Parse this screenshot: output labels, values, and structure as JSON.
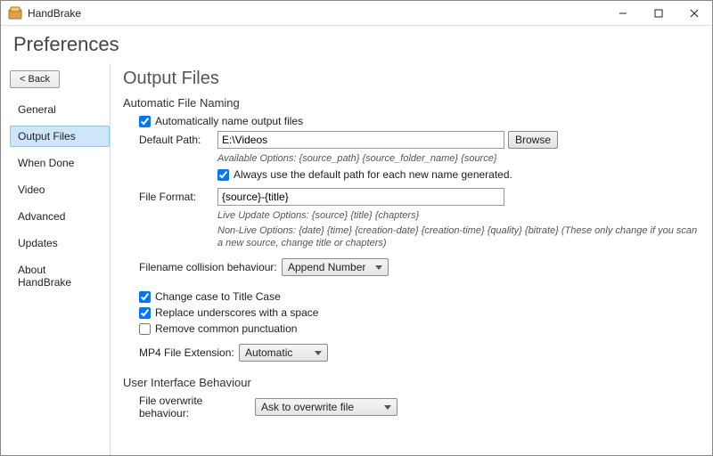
{
  "window": {
    "title": "HandBrake"
  },
  "page": {
    "title": "Preferences"
  },
  "back": {
    "label": "< Back"
  },
  "sidebar": {
    "items": [
      {
        "label": "General"
      },
      {
        "label": "Output Files"
      },
      {
        "label": "When Done"
      },
      {
        "label": "Video"
      },
      {
        "label": "Advanced"
      },
      {
        "label": "Updates"
      },
      {
        "label": "About HandBrake"
      }
    ],
    "selected": 1
  },
  "content": {
    "title": "Output Files",
    "group_naming": "Automatic File Naming",
    "auto_name_cb": "Automatically name output files",
    "auto_name_checked": true,
    "default_path_label": "Default Path:",
    "default_path_value": "E:\\Videos",
    "browse_label": "Browse",
    "default_path_hint": "Available Options: {source_path} {source_folder_name} {source}",
    "always_default_cb": "Always use the default path for each new name generated.",
    "always_default_checked": true,
    "file_format_label": "File Format:",
    "file_format_value": "{source}-{title}",
    "file_format_hint1": "Live Update Options: {source} {title} {chapters}",
    "file_format_hint2": "Non-Live Options: {date} {time} {creation-date} {creation-time} {quality} {bitrate} (These only change if you scan a new source, change title or chapters)",
    "collision_label": "Filename collision behaviour:",
    "collision_value": "Append Number",
    "title_case_cb": "Change case to Title Case",
    "title_case_checked": true,
    "replace_underscores_cb": "Replace underscores with a space",
    "replace_underscores_checked": true,
    "remove_punct_cb": "Remove common punctuation",
    "remove_punct_checked": false,
    "mp4_ext_label": "MP4 File Extension:",
    "mp4_ext_value": "Automatic",
    "group_ui": "User Interface Behaviour",
    "overwrite_label": "File overwrite behaviour:",
    "overwrite_value": "Ask to overwrite file"
  }
}
